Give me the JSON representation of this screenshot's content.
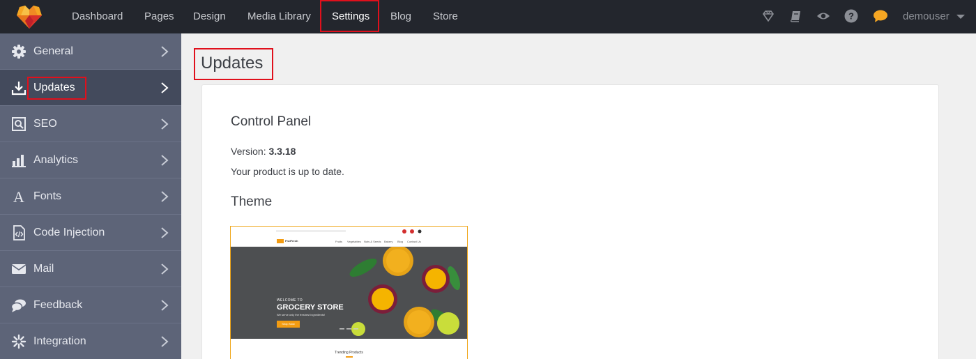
{
  "topbar": {
    "nav": [
      "Dashboard",
      "Pages",
      "Design",
      "Media Library",
      "Settings",
      "Blog",
      "Store"
    ],
    "active_nav": "Settings",
    "user": "demouser",
    "icons": [
      "diamond-icon",
      "book-icon",
      "eye-icon",
      "help-icon",
      "chat-icon"
    ],
    "colors": {
      "bar": "#23262d",
      "chat": "#f5a623",
      "highlight": "#e0101c"
    }
  },
  "sidebar": {
    "items": [
      {
        "label": "General",
        "icon": "gear-icon"
      },
      {
        "label": "Updates",
        "icon": "download-icon"
      },
      {
        "label": "SEO",
        "icon": "seo-icon"
      },
      {
        "label": "Analytics",
        "icon": "analytics-icon"
      },
      {
        "label": "Fonts",
        "icon": "font-icon"
      },
      {
        "label": "Code Injection",
        "icon": "code-file-icon"
      },
      {
        "label": "Mail",
        "icon": "mail-icon"
      },
      {
        "label": "Feedback",
        "icon": "feedback-icon"
      },
      {
        "label": "Integration",
        "icon": "integration-icon"
      }
    ],
    "active": "Updates"
  },
  "main": {
    "title": "Updates",
    "control_panel": {
      "heading": "Control Panel",
      "version_label": "Version:",
      "version": "3.3.18",
      "status": "Your product is up to date."
    },
    "theme": {
      "heading": "Theme",
      "preview": {
        "brand": "FruiFresh",
        "menu": [
          "Fruits",
          "Vegetables",
          "Nuts & Seeds",
          "Bakery",
          "Blog",
          "Contact Us"
        ],
        "hero_small": "WELCOME TO",
        "hero_title": "GROCERY STORE",
        "hero_sub": "We serve only the freshest ingredients!",
        "hero_button": "Shop Now",
        "section": "Trending Products"
      }
    }
  }
}
